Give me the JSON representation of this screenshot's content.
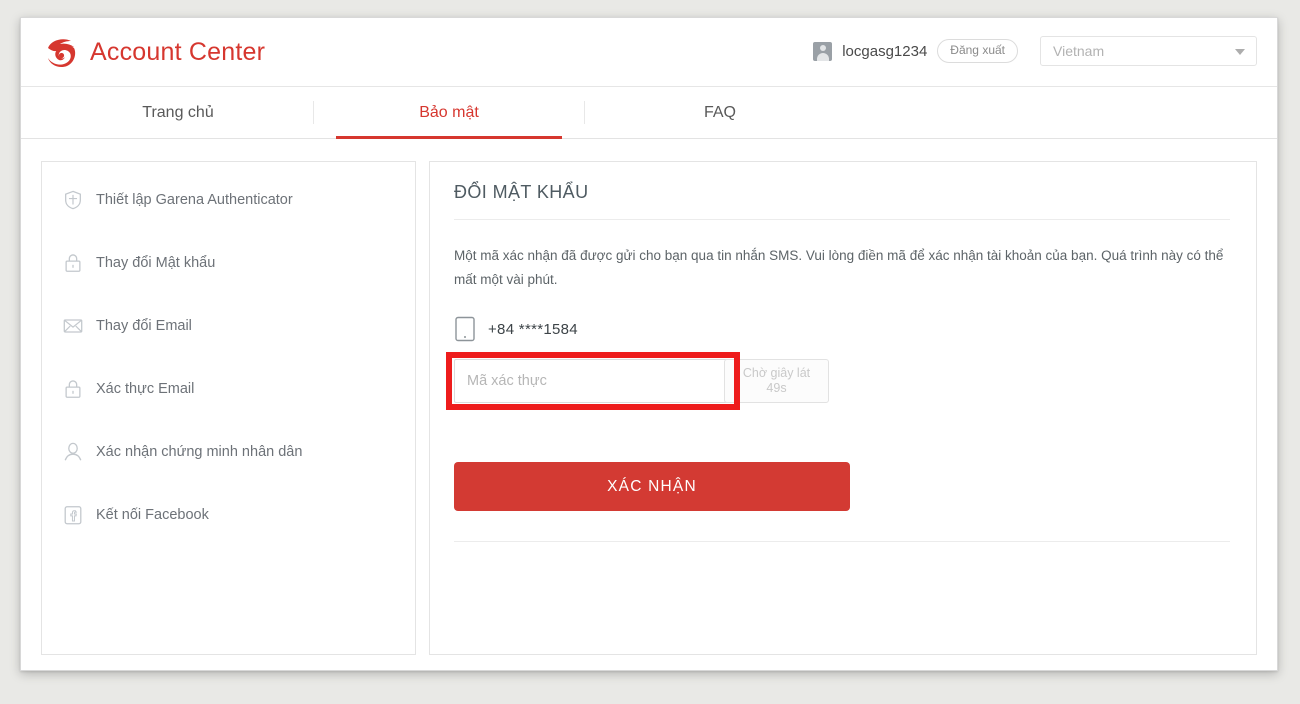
{
  "header": {
    "brand_title": "Account Center",
    "logo_icon": "garena-logo-icon",
    "avatar_icon": "user-avatar-icon",
    "username": "locgasg1234",
    "logout_label": "Đăng xuất",
    "country_value": "Vietnam",
    "caret_icon": "chevron-down-icon"
  },
  "tabs": [
    {
      "label": "Trang chủ",
      "active": false
    },
    {
      "label": "Bảo mật",
      "active": true
    },
    {
      "label": "FAQ",
      "active": false
    }
  ],
  "sidebar": {
    "items": [
      {
        "label": "Thiết lập Garena Authenticator",
        "icon": "shield-icon"
      },
      {
        "label": "Thay đổi Mật khẩu",
        "icon": "lock-icon"
      },
      {
        "label": "Thay đổi Email",
        "icon": "envelope-icon"
      },
      {
        "label": "Xác thực Email",
        "icon": "lock-icon"
      },
      {
        "label": "Xác nhận chứng minh nhân dân",
        "icon": "person-icon"
      },
      {
        "label": "Kết nối Facebook",
        "icon": "facebook-icon"
      }
    ]
  },
  "main": {
    "title": "ĐỔI MẬT KHẨU",
    "description": "Một mã xác nhận đã được gửi cho bạn qua tin nhắn SMS. Vui lòng điền mã để xác nhận tài khoản của bạn. Quá trình này có thể mất một vài phút.",
    "phone_icon": "mobile-phone-icon",
    "phone_number": "+84 ****1584",
    "code_input": {
      "placeholder": "Mã xác thực",
      "value": ""
    },
    "resend_button": {
      "line1": "Chờ giây lát",
      "line2": "49s"
    },
    "confirm_label": "XÁC NHẬN"
  },
  "colors": {
    "brand_red": "#d6372f",
    "button_red": "#d33a33",
    "annotation_red": "#ee1c1c",
    "page_background": "#e9e9e6",
    "text_gray": "#6d7278"
  }
}
